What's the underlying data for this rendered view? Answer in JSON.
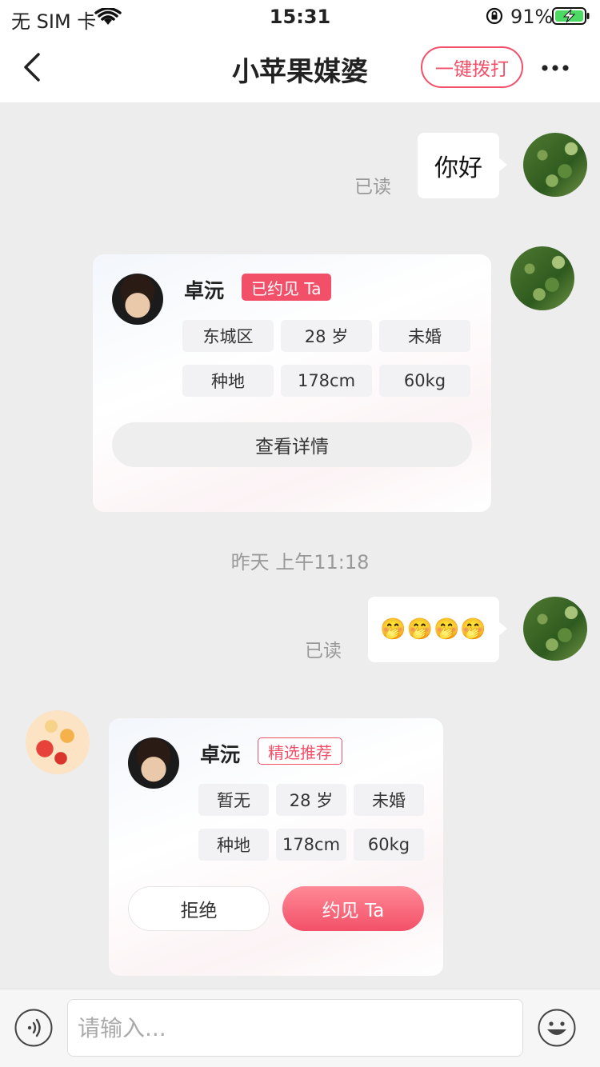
{
  "status_bar": {
    "carrier": "无 SIM 卡",
    "time": "15:31",
    "battery_pct": "91%"
  },
  "nav": {
    "title": "小苹果媒婆",
    "call_label": "一键拨打"
  },
  "messages": {
    "msg1": {
      "text": "你好",
      "read": "已读"
    },
    "card1": {
      "name": "卓沅",
      "tag": "已约见 Ta",
      "attrs": [
        "东城区",
        "28 岁",
        "未婚",
        "种地",
        "178cm",
        "60kg"
      ],
      "detail_label": "查看详情"
    },
    "timestamp": "昨天 上午11:18",
    "msg2": {
      "text": "🤭🤭🤭🤭",
      "read": "已读"
    },
    "card2": {
      "name": "卓沅",
      "tag": "精选推荐",
      "attrs": [
        "暂无",
        "28 岁",
        "未婚",
        "种地",
        "178cm",
        "60kg"
      ],
      "reject_label": "拒绝",
      "meet_label": "约见 Ta"
    }
  },
  "input": {
    "placeholder": "请输入..."
  },
  "colors": {
    "accent": "#f25068",
    "background": "#ededed"
  }
}
